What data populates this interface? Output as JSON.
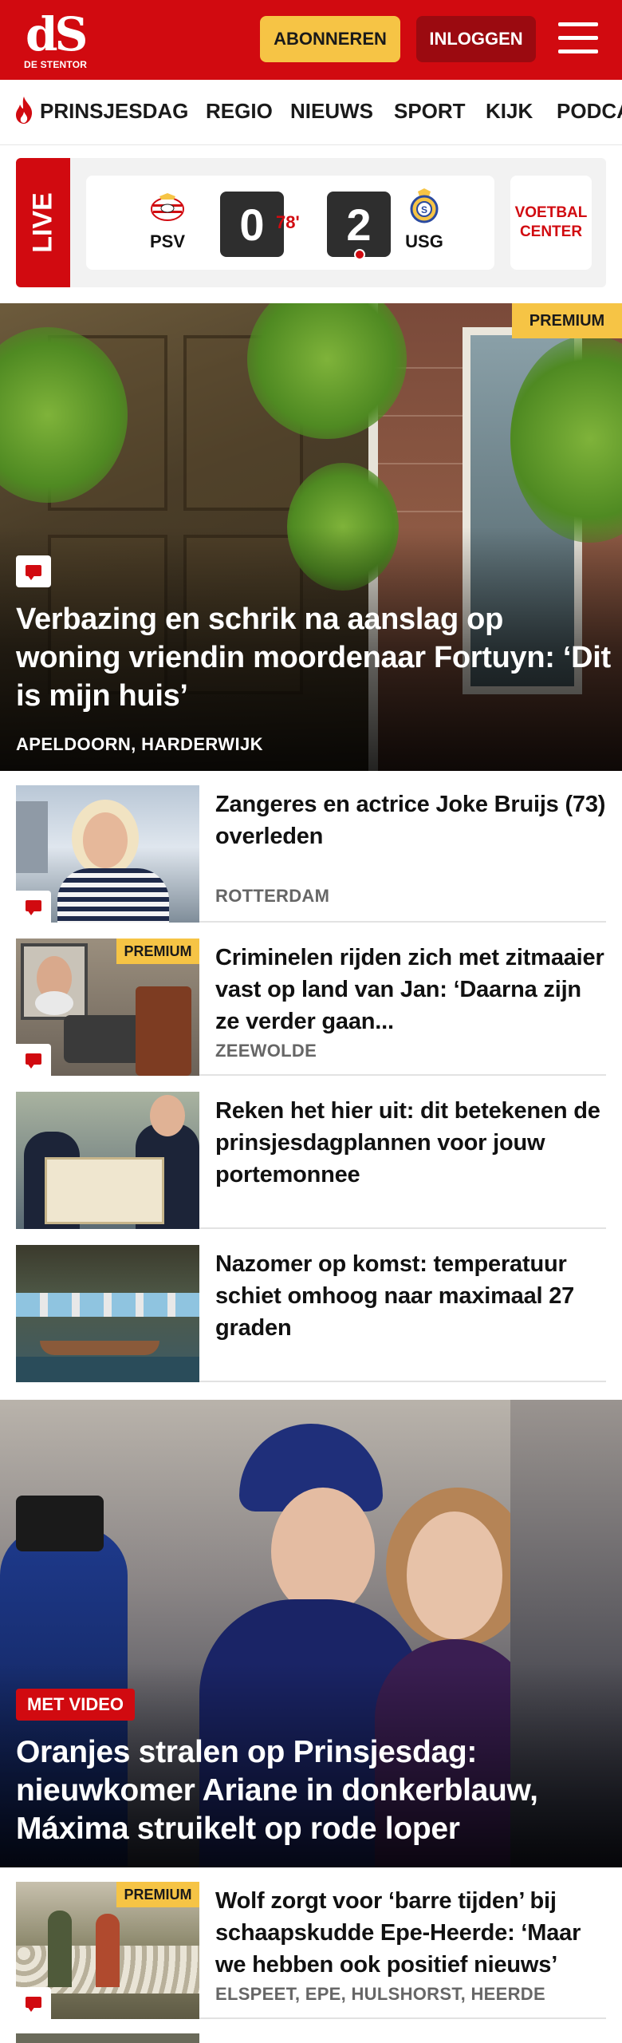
{
  "header": {
    "logo_mark": "dS",
    "logo_text": "DE STENTOR",
    "subscribe_label": "ABONNEREN",
    "login_label": "INLOGGEN",
    "menu_icon": "hamburger-menu-icon",
    "brand_color": "#d10a10"
  },
  "nav": {
    "items": [
      {
        "label": "PRINSJESDAG",
        "icon": "flame-icon"
      },
      {
        "label": "REGIO"
      },
      {
        "label": "NIEUWS"
      },
      {
        "label": "SPORT"
      },
      {
        "label": "KIJK"
      },
      {
        "label": "PODCA"
      }
    ]
  },
  "live": {
    "tag": "LIVE",
    "home_team": "PSV",
    "home_score": "0",
    "minute": "78'",
    "away_score": "2",
    "away_team": "USG",
    "center_label_line1": "VOETBAL",
    "center_label_line2": "CENTER"
  },
  "hero": {
    "badge": "PREMIUM",
    "title": "Verbazing en schrik na aanslag op woning vriendin moordenaar Fortuyn: ‘Dit is mijn huis’",
    "location": "APELDOORN, HARDERWIJK",
    "comment_icon": "comment-icon"
  },
  "articles": [
    {
      "title": "Zangeres en actrice Joke Bruijs (73) overleden",
      "location": "ROTTERDAM",
      "premium": false,
      "comments": true
    },
    {
      "title": "Criminelen rijden zich met zitmaaier vast op land van Jan: ‘Daarna zijn ze verder gaan...",
      "location": "ZEEWOLDE",
      "premium": true,
      "badge": "PREMIUM",
      "comments": true
    },
    {
      "title": "Reken het hier uit: dit betekenen de prinsjesdagplannen voor jouw portemonnee",
      "location": "",
      "premium": false,
      "comments": false
    },
    {
      "title": "Nazomer op komst: temperatuur schiet omhoog naar maximaal 27 graden",
      "location": "",
      "premium": false,
      "comments": false
    }
  ],
  "hero2": {
    "badge": "MET VIDEO",
    "title": "Oranjes stralen op Prinsjesdag: nieuwkomer Ariane in donkerblauw, Máxima struikelt op rode loper"
  },
  "bottom_article": {
    "badge": "PREMIUM",
    "title": "Wolf zorgt voor ‘barre tijden’ bij schaapskudde Epe-Heerde: ‘Maar we hebben ook positief nieuws’",
    "location": "ELSPEET, EPE, HULSHORST, HEERDE"
  }
}
